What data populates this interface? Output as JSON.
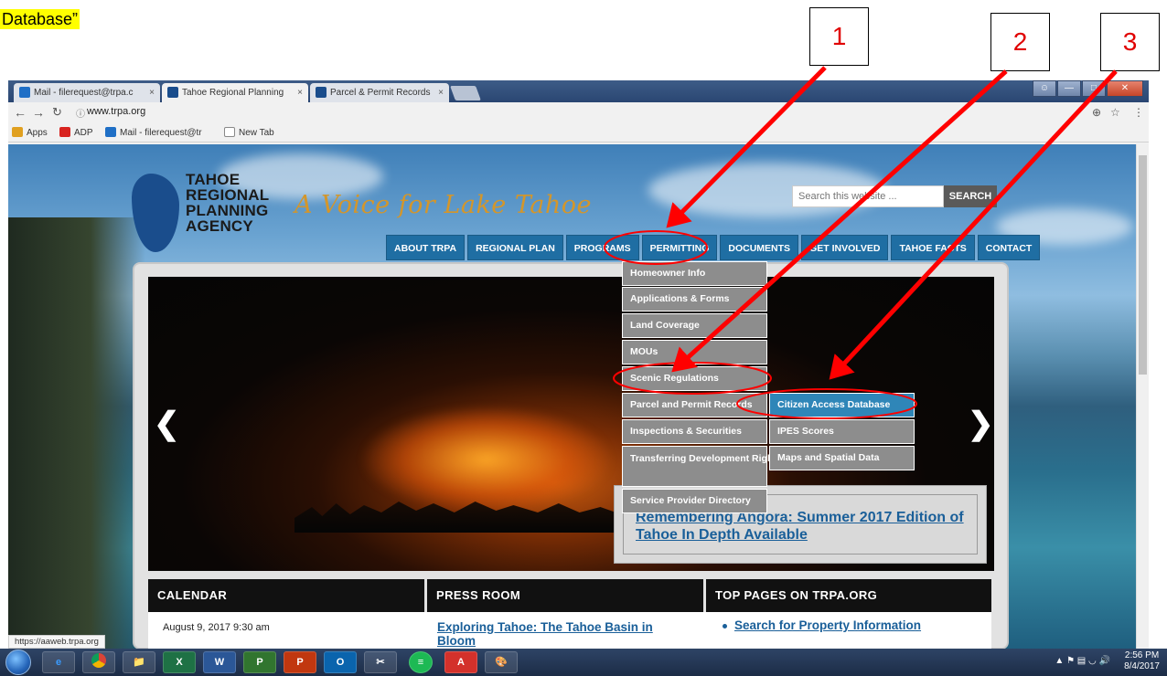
{
  "caption": "Database”",
  "callouts": [
    "1",
    "2",
    "3"
  ],
  "browser": {
    "tabs": [
      {
        "title": "Mail - filerequest@trpa.c",
        "icon": "outlook-icon"
      },
      {
        "title": "Tahoe Regional Planning",
        "icon": "trpa-icon"
      },
      {
        "title": "Parcel & Permit Records",
        "icon": "trpa-icon"
      }
    ],
    "tab_close": "×",
    "url": "www.trpa.org",
    "bookmarks": [
      "Apps",
      "ADP",
      "Mail - filerequest@tr",
      "New Tab"
    ],
    "status_url": "https://aaweb.trpa.org"
  },
  "site": {
    "logo_lines": [
      "TAHOE",
      "REGIONAL",
      "PLANNING",
      "AGENCY"
    ],
    "tagline": "A Voice for Lake Tahoe",
    "search_placeholder": "Search this website ...",
    "search_button": "SEARCH",
    "nav": [
      "ABOUT TRPA",
      "REGIONAL PLAN",
      "PROGRAMS",
      "PERMITTING",
      "DOCUMENTS",
      "GET INVOLVED",
      "TAHOE FACTS",
      "CONTACT"
    ],
    "dropdown": [
      "Homeowner Info",
      "Applications & Forms",
      "Land Coverage",
      "MOUs",
      "Scenic Regulations",
      "Parcel and Permit Records",
      "Inspections & Securities",
      "Transferring Development Rights",
      "Service Provider Directory"
    ],
    "submenu": [
      "Citizen Access Database",
      "IPES Scores",
      "Maps and Spatial Data"
    ],
    "slide_caption": "Remembering Angora: Summer 2017 Edition of Tahoe In Depth Available",
    "panels": [
      {
        "title": "CALENDAR",
        "text": "August 9, 2017 9:30 am"
      },
      {
        "title": "PRESS ROOM",
        "text": "Exploring Tahoe: The Tahoe Basin in Bloom"
      },
      {
        "title": "TOP PAGES ON TRPA.ORG",
        "text": "Search for Property Information"
      }
    ]
  },
  "taskbar": {
    "clock_time": "2:56 PM",
    "clock_date": "8/4/2017"
  },
  "colors": {
    "annotation_red": "#ff0000",
    "nav_blue": "#1f6ea3",
    "highlight_blue": "#2f86b8",
    "dropdown_gray": "#8d8d8d"
  }
}
